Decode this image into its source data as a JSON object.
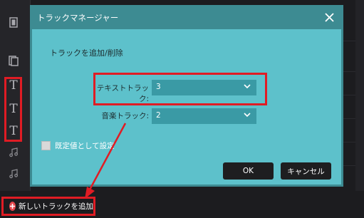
{
  "dialog": {
    "title": "トラックマネージャー",
    "section_title": "トラックを追加/削除",
    "text_track": {
      "label": "テキストトラック:",
      "value": "3"
    },
    "music_track": {
      "label": "音楽トラック:",
      "value": "2"
    },
    "default_checkbox": {
      "label": "既定値として設定",
      "checked": false
    },
    "ok_label": "OK",
    "cancel_label": "キャンセル"
  },
  "bottom": {
    "add_track_label": "新しいトラックを追加"
  },
  "tracks": {
    "icons": [
      "film-icon",
      "pip-icon",
      "text-icon",
      "text-icon",
      "text-icon",
      "music-note-icon",
      "music-note-icon"
    ],
    "text_letter": "T"
  },
  "colors": {
    "highlight": "#e01c24",
    "dialog_body": "#5dc1cb",
    "dialog_title_bar": "#3d8b92",
    "select_bg": "#3a9aa5",
    "button_bg": "#1e1e20"
  }
}
